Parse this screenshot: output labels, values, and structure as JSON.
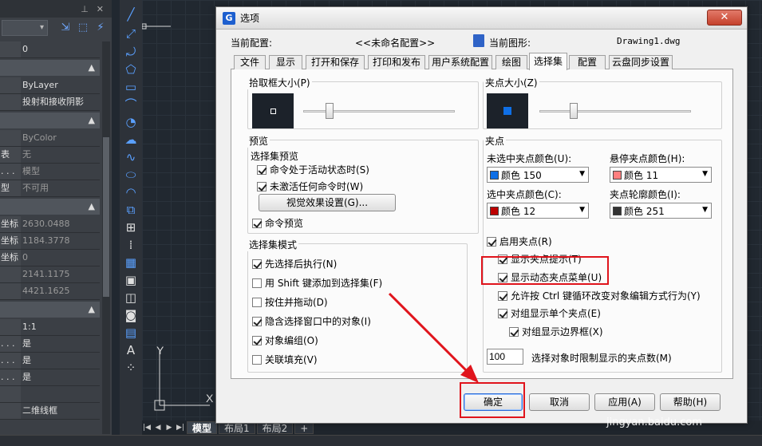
{
  "props": {
    "rows": [
      {
        "k": "",
        "v": "0"
      },
      {
        "k": "",
        "v": "ByLayer"
      },
      {
        "k": "",
        "v": "投射和接收阴影"
      },
      {
        "k": "",
        "v": "ByColor"
      },
      {
        "k": "表",
        "v": "无"
      },
      {
        "k": ". . .",
        "v": "模型"
      },
      {
        "k": "型",
        "v": "不可用"
      },
      {
        "k": "坐标",
        "v": "2630.0488"
      },
      {
        "k": "坐标",
        "v": "1184.3778"
      },
      {
        "k": "坐标",
        "v": "0"
      },
      {
        "k": "",
        "v": "2141.1175"
      },
      {
        "k": "",
        "v": "4421.1625"
      },
      {
        "k": "",
        "v": "1:1"
      },
      {
        "k": ". . .",
        "v": "是"
      },
      {
        "k": ". . .",
        "v": "是"
      },
      {
        "k": ". . .",
        "v": "是"
      },
      {
        "k": "",
        "v": ""
      },
      {
        "k": "",
        "v": "二维线框"
      }
    ]
  },
  "layout_tabs": [
    "模型",
    "布局1",
    "布局2",
    "+"
  ],
  "dialog": {
    "title": "选项",
    "close_label": "✕",
    "current_config_label": "当前配置:",
    "current_config_value": "<<未命名配置>>",
    "current_drawing_label": "当前图形:",
    "current_drawing_value": "Drawing1.dwg",
    "tabs": [
      "文件",
      "显示",
      "打开和保存",
      "打印和发布",
      "用户系统配置",
      "绘图",
      "选择集",
      "配置",
      "云盘同步设置"
    ],
    "active_tab": "选择集",
    "pickbox_label": "拾取框大小(P)",
    "grip_size_label": "夹点大小(Z)",
    "preview_group": "预览",
    "preview_sub": "选择集预览",
    "preview_checks": [
      {
        "label": "命令处于活动状态时(S)",
        "checked": true
      },
      {
        "label": "未激活任何命令时(W)",
        "checked": true
      }
    ],
    "visual_effects_button": "视觉效果设置(G)...",
    "command_preview": {
      "label": "命令预览",
      "checked": true
    },
    "mode_group": "选择集模式",
    "mode_checks": [
      {
        "label": "先选择后执行(N)",
        "checked": true
      },
      {
        "label": "用 Shift 键添加到选择集(F)",
        "checked": false
      },
      {
        "label": "按住并拖动(D)",
        "checked": false
      },
      {
        "label": "隐含选择窗口中的对象(I)",
        "checked": true
      },
      {
        "label": "对象编组(O)",
        "checked": true
      },
      {
        "label": "关联填充(V)",
        "checked": false
      }
    ],
    "grips_group": "夹点",
    "unselected_color_label": "未选中夹点颜色(U):",
    "unselected_color": {
      "text": "颜色 150",
      "hex": "#0f6fe6"
    },
    "hover_color_label": "悬停夹点颜色(H):",
    "hover_color": {
      "text": "颜色 11",
      "hex": "#ff7f7f"
    },
    "selected_color_label": "选中夹点颜色(C):",
    "selected_color": {
      "text": "颜色 12",
      "hex": "#bd0000"
    },
    "contour_color_label": "夹点轮廓颜色(I):",
    "contour_color": {
      "text": "颜色 251",
      "hex": "#333333"
    },
    "grip_checks": [
      {
        "label": "启用夹点(R)",
        "checked": true
      },
      {
        "label": "显示夹点提示(T)",
        "checked": true
      },
      {
        "label": "显示动态夹点菜单(U)",
        "checked": true
      },
      {
        "label": "允许按 Ctrl 键循环改变对象编辑方式行为(Y)",
        "checked": true
      },
      {
        "label": "对组显示单个夹点(E)",
        "checked": true
      },
      {
        "label": "对组显示边界框(X)",
        "checked": true
      }
    ],
    "grip_limit_value": "100",
    "grip_limit_label": "选择对象时限制显示的夹点数(M)",
    "ok": "确定",
    "cancel": "取消",
    "apply": "应用(A)",
    "help": "帮助(H)"
  },
  "watermark": "jingyan.baidu.com",
  "colors": {
    "highlight": "#e0141c"
  }
}
